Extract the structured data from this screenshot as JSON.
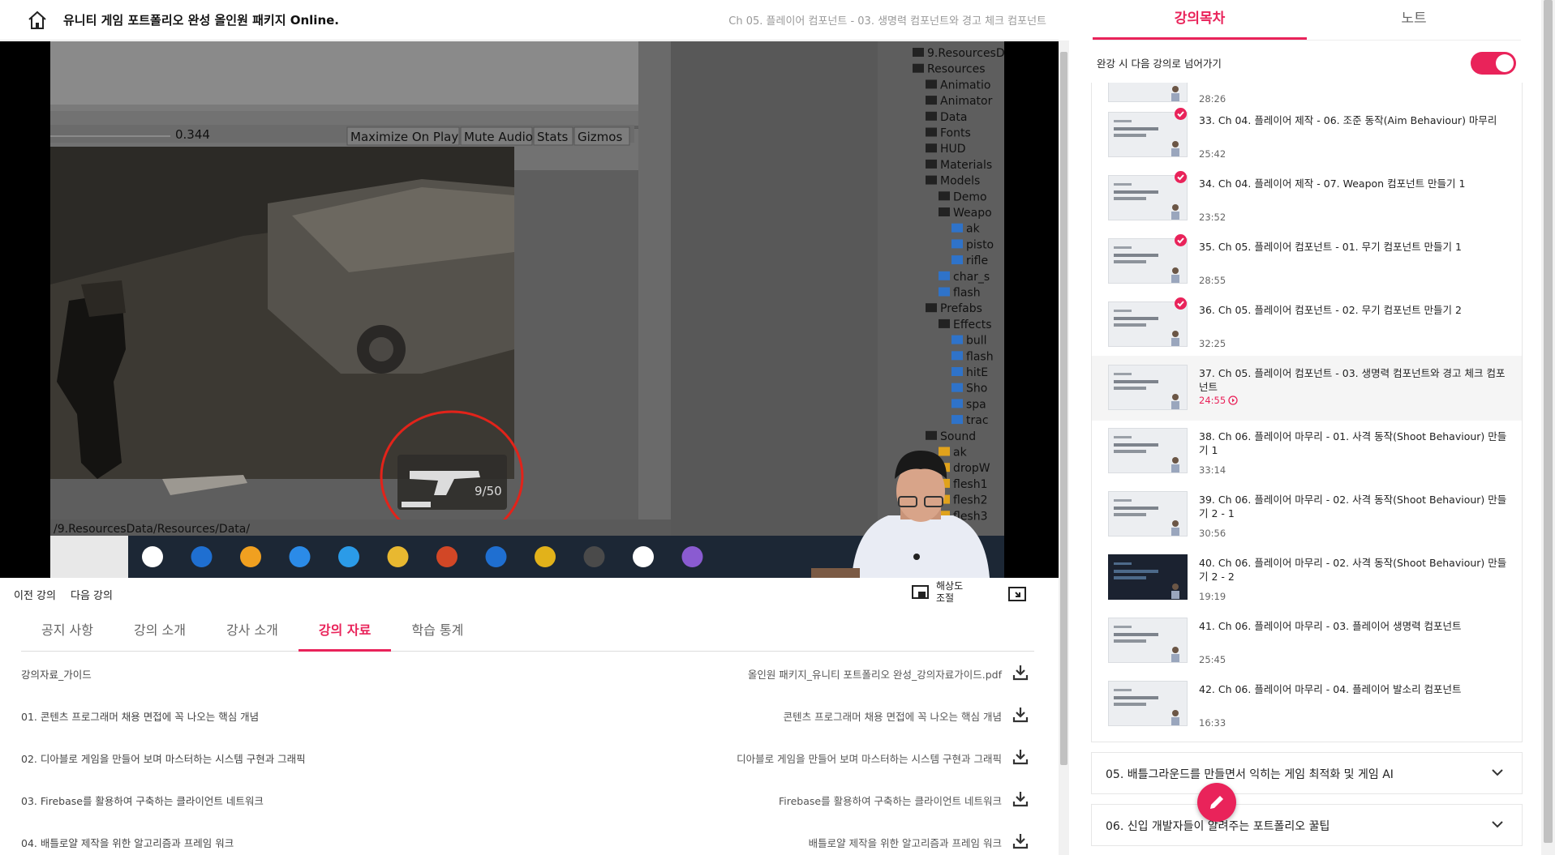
{
  "header": {
    "course_title": "유니티 게임 포트폴리오 완성 올인원 패키지 Online.",
    "chapter_title": "Ch 05. 플레이어 컴포넌트 - 03. 생명력 컴포넌트와 경고 체크 컴포넌트"
  },
  "video": {
    "scene_value": "0.344",
    "toolbar": [
      "Maximize On Play",
      "Mute Audio",
      "Stats",
      "Gizmos"
    ],
    "path": "/9.ResourcesData/Resources/Data/",
    "ammo": "9/50",
    "hierarchy": [
      {
        "label": "9.ResourcesD",
        "indent": 0,
        "type": "folder"
      },
      {
        "label": "Resources",
        "indent": 0,
        "type": "folder"
      },
      {
        "label": "Animatio",
        "indent": 1,
        "type": "folder"
      },
      {
        "label": "Animator",
        "indent": 1,
        "type": "folder"
      },
      {
        "label": "Data",
        "indent": 1,
        "type": "folder"
      },
      {
        "label": "Fonts",
        "indent": 1,
        "type": "folder"
      },
      {
        "label": "HUD",
        "indent": 1,
        "type": "folder"
      },
      {
        "label": "Materials",
        "indent": 1,
        "type": "folder"
      },
      {
        "label": "Models",
        "indent": 1,
        "type": "folder"
      },
      {
        "label": "Demo",
        "indent": 2,
        "type": "folder"
      },
      {
        "label": "Weapo",
        "indent": 2,
        "type": "folder"
      },
      {
        "label": "ak",
        "indent": 3,
        "type": "cube"
      },
      {
        "label": "pisto",
        "indent": 3,
        "type": "cube"
      },
      {
        "label": "rifle",
        "indent": 3,
        "type": "cube"
      },
      {
        "label": "char_s",
        "indent": 2,
        "type": "cube"
      },
      {
        "label": "flash",
        "indent": 2,
        "type": "cube"
      },
      {
        "label": "Prefabs",
        "indent": 1,
        "type": "folder"
      },
      {
        "label": "Effects",
        "indent": 2,
        "type": "folder"
      },
      {
        "label": "bull",
        "indent": 3,
        "type": "cube"
      },
      {
        "label": "flash",
        "indent": 3,
        "type": "cube"
      },
      {
        "label": "hitE",
        "indent": 3,
        "type": "cube"
      },
      {
        "label": "Sho",
        "indent": 3,
        "type": "cube"
      },
      {
        "label": "spa",
        "indent": 3,
        "type": "cube"
      },
      {
        "label": "trac",
        "indent": 3,
        "type": "cube"
      },
      {
        "label": "Sound",
        "indent": 1,
        "type": "folder"
      },
      {
        "label": "ak",
        "indent": 2,
        "type": "audio"
      },
      {
        "label": "dropW",
        "indent": 2,
        "type": "audio"
      },
      {
        "label": "flesh1",
        "indent": 2,
        "type": "audio"
      },
      {
        "label": "flesh2",
        "indent": 2,
        "type": "audio"
      },
      {
        "label": "flesh3",
        "indent": 2,
        "type": "audio"
      }
    ]
  },
  "controls": {
    "prev": "이전 강의",
    "next": "다음 강의",
    "resolution": "해상도 조절"
  },
  "tabs": [
    {
      "label": "공지 사항",
      "active": false
    },
    {
      "label": "강의 소개",
      "active": false
    },
    {
      "label": "강사 소개",
      "active": false
    },
    {
      "label": "강의 자료",
      "active": true
    },
    {
      "label": "학습 통계",
      "active": false
    }
  ],
  "materials": [
    {
      "title": "강의자료_가이드",
      "file": "올인원 패키지_유니티 포트폴리오 완성_강의자료가이드.pdf"
    },
    {
      "title": "01. 콘텐츠 프로그래머 채용 면접에 꼭 나오는 핵심 개념",
      "file": "콘텐츠 프로그래머 채용 면접에 꼭 나오는 핵심 개념"
    },
    {
      "title": "02. 디아블로 게임을 만들어 보며 마스터하는 시스템 구현과 그래픽",
      "file": "디아블로 게임을 만들어 보며 마스터하는 시스템 구현과 그래픽"
    },
    {
      "title": "03. Firebase를 활용하여 구축하는 클라이언트 네트워크",
      "file": "Firebase를 활용하여 구축하는 클라이언트 네트워크"
    },
    {
      "title": "04. 배틀로얄 제작을 위한 알고리즘과 프레임 워크",
      "file": "배틀로얄 제작을 위한 알고리즘과 프레임 워크"
    }
  ],
  "sidebar": {
    "tabs": [
      {
        "label": "강의목차",
        "active": true
      },
      {
        "label": "노트",
        "active": false
      }
    ],
    "autoplay_label": "완강 시 다음 강의로 넘어가기",
    "autoplay_on": true,
    "lectures": [
      {
        "title": "",
        "duration": "28:26",
        "completed": false,
        "current": false,
        "thumb": "slide"
      },
      {
        "title": "33. Ch 04. 플레이어 제작 - 06. 조준 동작(Aim Behaviour) 마무리",
        "duration": "25:42",
        "completed": true,
        "current": false,
        "thumb": "slide"
      },
      {
        "title": "34. Ch 04. 플레이어 제작 - 07. Weapon 컴포넌트 만들기 1",
        "duration": "23:52",
        "completed": true,
        "current": false,
        "thumb": "slide"
      },
      {
        "title": "35. Ch 05. 플레이어 컴포넌트 - 01. 무기 컴포넌트 만들기 1",
        "duration": "28:55",
        "completed": true,
        "current": false,
        "thumb": "slide"
      },
      {
        "title": "36. Ch 05. 플레이어 컴포넌트 - 02. 무기 컴포넌트 만들기 2",
        "duration": "32:25",
        "completed": true,
        "current": false,
        "thumb": "slide"
      },
      {
        "title": "37. Ch 05. 플레이어 컴포넌트 - 03. 생명력 컴포넌트와 경고 체크 컴포넌트",
        "duration": "24:55",
        "completed": false,
        "current": true,
        "thumb": "slide"
      },
      {
        "title": "38. Ch 06. 플레이어 마무리 - 01. 사격 동작(Shoot Behaviour) 만들기 1",
        "duration": "33:14",
        "completed": false,
        "current": false,
        "thumb": "slide"
      },
      {
        "title": "39. Ch 06. 플레이어 마무리 - 02. 사격 동작(Shoot Behaviour) 만들기 2 - 1",
        "duration": "30:56",
        "completed": false,
        "current": false,
        "thumb": "slide"
      },
      {
        "title": "40. Ch 06. 플레이어 마무리 - 02. 사격 동작(Shoot Behaviour) 만들기 2 - 2",
        "duration": "19:19",
        "completed": false,
        "current": false,
        "thumb": "dark"
      },
      {
        "title": "41. Ch 06. 플레이어 마무리 - 03. 플레이어 생명력 컴포넌트",
        "duration": "25:45",
        "completed": false,
        "current": false,
        "thumb": "slide"
      },
      {
        "title": "42. Ch 06. 플레이어 마무리 - 04. 플레이어 발소리 컴포넌트",
        "duration": "16:33",
        "completed": false,
        "current": false,
        "thumb": "slide"
      }
    ],
    "sections": [
      {
        "title": "05. 배틀그라운드를 만들면서 익히는 게임 최적화 및 게임 AI"
      },
      {
        "title": "06. 신입 개발자들이 알려주는 포트폴리오 꿀팁"
      }
    ]
  },
  "colors": {
    "accent": "#e9235a"
  }
}
